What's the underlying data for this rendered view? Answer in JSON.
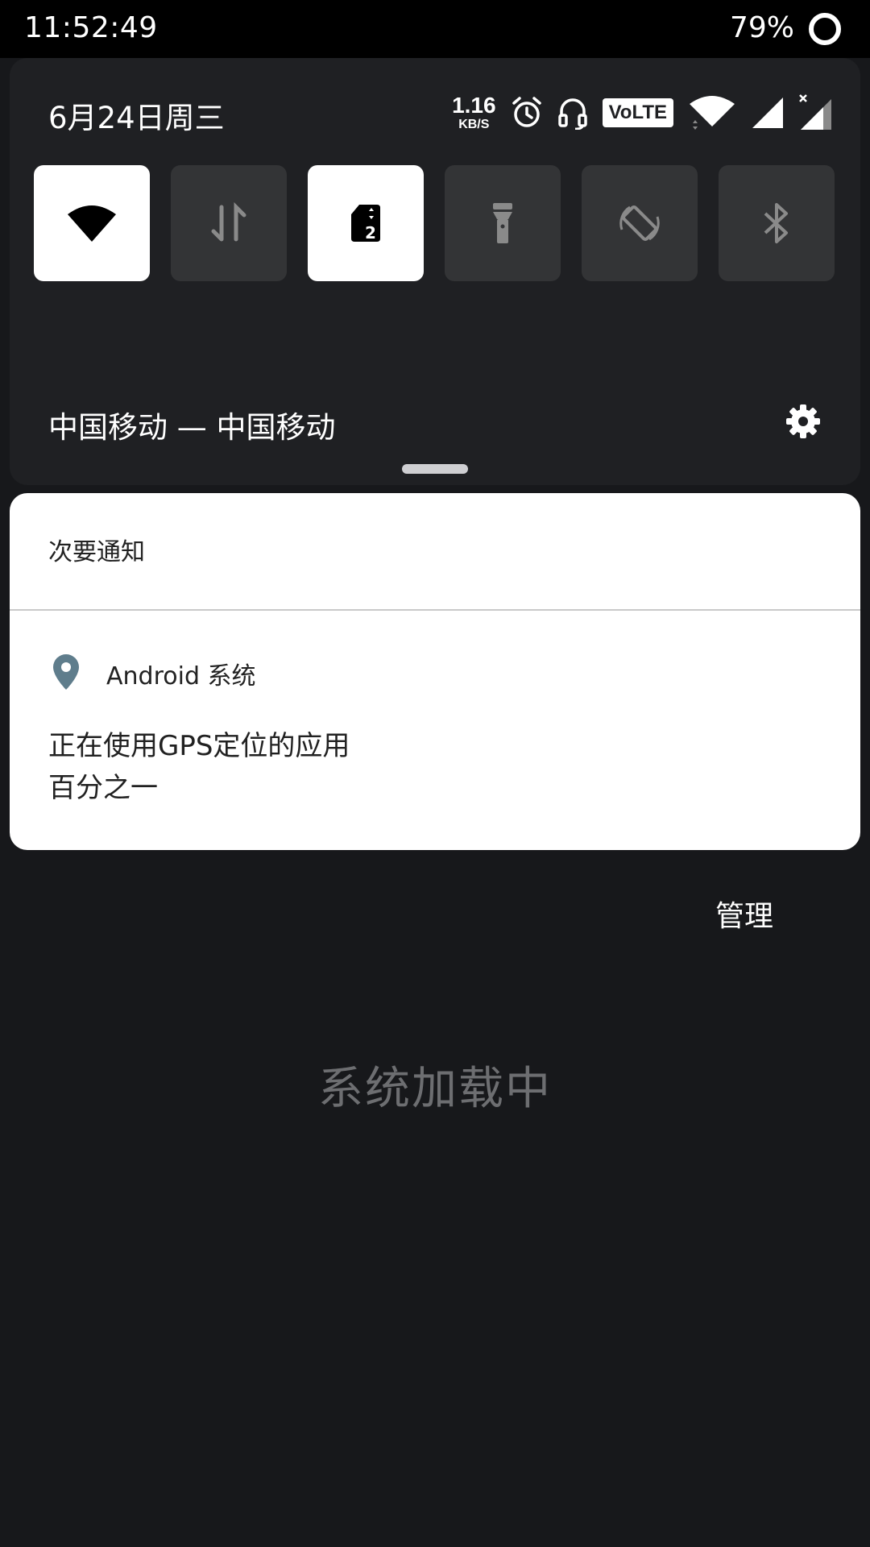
{
  "status_bar": {
    "time": "11:52:49",
    "battery": "79%"
  },
  "quick_settings": {
    "date": "6月24日周三",
    "net_speed_value": "1.16",
    "net_speed_unit": "KB/S",
    "volte_label": "VoLTE",
    "carrier": "中国移动 — 中国移动",
    "tiles": [
      {
        "name": "wifi",
        "icon": "wifi-icon",
        "active": true
      },
      {
        "name": "mobile-data",
        "icon": "data-arrows-icon",
        "active": false
      },
      {
        "name": "sim-2",
        "icon": "sim-card-2-icon",
        "active": true
      },
      {
        "name": "flashlight",
        "icon": "flashlight-icon",
        "active": false
      },
      {
        "name": "auto-rotate",
        "icon": "rotate-icon",
        "active": false
      },
      {
        "name": "bluetooth",
        "icon": "bluetooth-icon",
        "active": false
      }
    ]
  },
  "notification": {
    "section_title": "次要通知",
    "app_name": "Android 系统",
    "title": "正在使用GPS定位的应用",
    "text": "百分之一"
  },
  "manage_label": "管理",
  "loading_text": "系统加载中",
  "colors": {
    "background": "#17181b",
    "panel": "#1f2023",
    "tile_inactive": "#333436",
    "tile_active": "#ffffff",
    "location_pin": "#5f7d8c"
  }
}
